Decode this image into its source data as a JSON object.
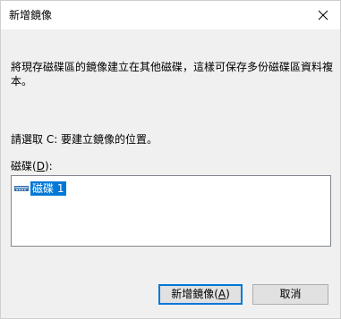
{
  "window": {
    "title": "新增鏡像",
    "close_icon": "close-icon"
  },
  "description": "將現存磁碟區的鏡像建立在其他磁碟，這樣可保存多份磁碟區資料複本。",
  "prompt": "請選取 C: 要建立鏡像的位置。",
  "disk_list": {
    "label_prefix": "磁碟(",
    "label_mnemonic": "D",
    "label_suffix": "):",
    "items": [
      {
        "label": "磁碟 1",
        "selected": true,
        "icon": "disk-icon"
      }
    ]
  },
  "buttons": {
    "ok_prefix": "新增鏡像(",
    "ok_mnemonic": "A",
    "ok_suffix": ")",
    "cancel": "取消"
  },
  "colors": {
    "selection": "#0078d7",
    "dialog_bg": "#f0f0f0",
    "focus_border": "#0078d7"
  }
}
